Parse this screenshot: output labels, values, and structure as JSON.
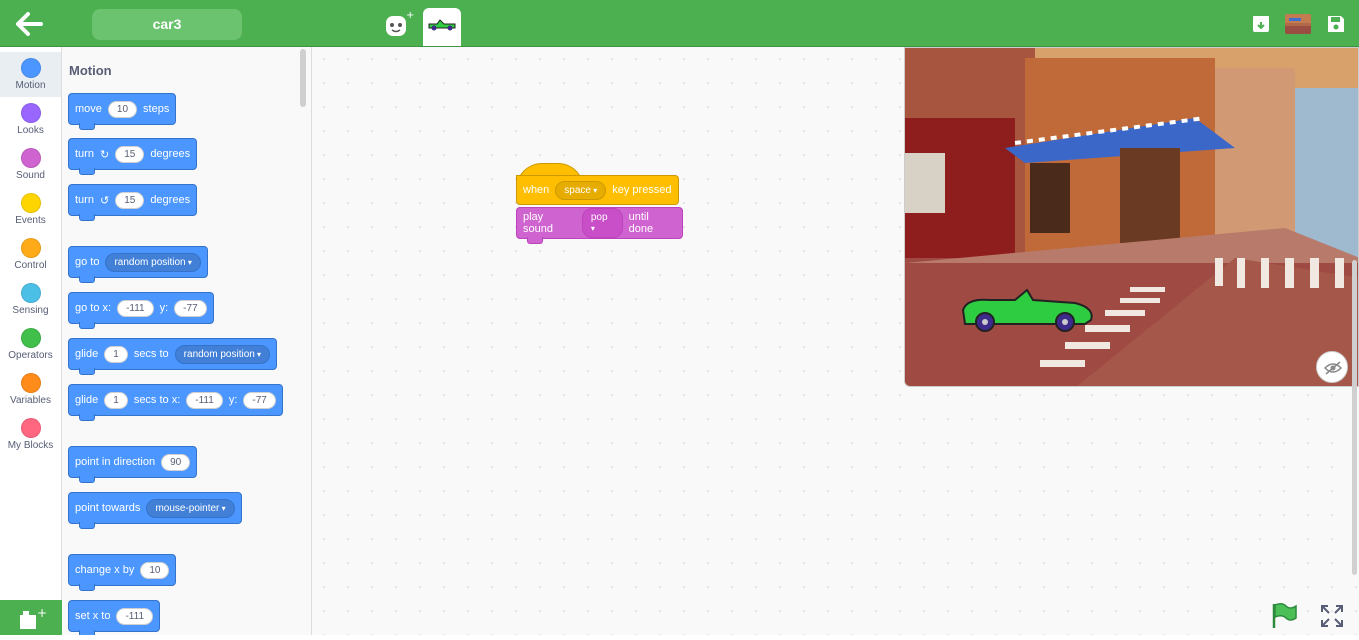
{
  "header": {
    "project_name": "car3",
    "icons": [
      "back-arrow-icon",
      "add-sprite-icon",
      "car-sprite-icon",
      "download-icon",
      "backdrop-thumbnail",
      "save-icon"
    ]
  },
  "categories": [
    {
      "label": "Motion",
      "color": "#4c97ff"
    },
    {
      "label": "Looks",
      "color": "#9966ff"
    },
    {
      "label": "Sound",
      "color": "#cf63cf"
    },
    {
      "label": "Events",
      "color": "#ffd500"
    },
    {
      "label": "Control",
      "color": "#ffab19"
    },
    {
      "label": "Sensing",
      "color": "#4cbfe6"
    },
    {
      "label": "Operators",
      "color": "#40bf4a"
    },
    {
      "label": "Variables",
      "color": "#ff8c1a"
    },
    {
      "label": "My Blocks",
      "color": "#ff6680"
    }
  ],
  "palette": {
    "title": "Motion",
    "move": {
      "label": "move",
      "value": "10",
      "suffix": "steps"
    },
    "turn_right": {
      "label": "turn",
      "value": "15",
      "suffix": "degrees"
    },
    "turn_left": {
      "label": "turn",
      "value": "15",
      "suffix": "degrees"
    },
    "go_to": {
      "label": "go to",
      "option": "random position"
    },
    "go_to_xy": {
      "label": "go to x:",
      "x": "-111",
      "ylabel": "y:",
      "y": "-77"
    },
    "glide_to": {
      "label": "glide",
      "value": "1",
      "mid": "secs to",
      "option": "random position"
    },
    "glide_xy": {
      "label": "glide",
      "value": "1",
      "mid": "secs to x:",
      "x": "-111",
      "ylabel": "y:",
      "y": "-77"
    },
    "point_dir": {
      "label": "point in direction",
      "value": "90"
    },
    "point_towards": {
      "label": "point towards",
      "option": "mouse-pointer"
    },
    "change_x": {
      "label": "change x by",
      "value": "10"
    },
    "set_x": {
      "label": "set x to",
      "value": "-111"
    }
  },
  "script": {
    "hat": {
      "when": "when",
      "key": "space",
      "suffix": "key pressed"
    },
    "sound": {
      "label": "play sound",
      "option": "pop",
      "suffix": "until done"
    }
  },
  "colors": {
    "accent": "#4caf50",
    "motion": "#4c97ff",
    "events": "#ffbf00",
    "sound": "#cf63cf"
  }
}
